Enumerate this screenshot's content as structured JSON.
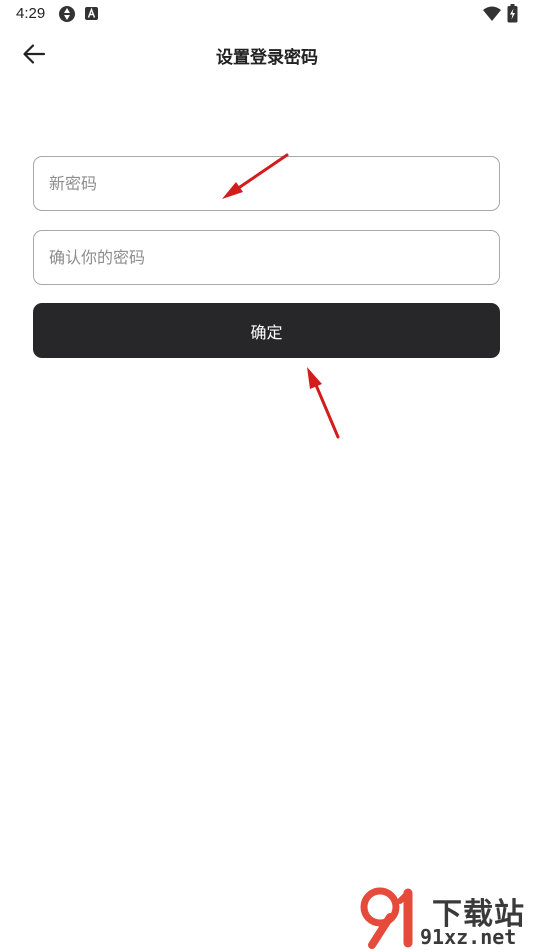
{
  "status_bar": {
    "time": "4:29",
    "icons": [
      "sync-icon",
      "a-badge-icon",
      "wifi-icon",
      "battery-charging-icon"
    ]
  },
  "header": {
    "back_icon": "arrow-left-icon",
    "title": "设置登录密码"
  },
  "form": {
    "new_password": {
      "placeholder": "新密码",
      "value": ""
    },
    "confirm_password": {
      "placeholder": "确认你的密码",
      "value": ""
    },
    "submit_label": "确定"
  },
  "annotations": {
    "arrow_color": "#d21d1d",
    "arrows": [
      "red-arrow-to-new-password",
      "red-arrow-to-confirm-button"
    ]
  },
  "watermark": {
    "text_cn": "下载站",
    "text_en": "91xz.net",
    "logo_color": "#e64a3b"
  },
  "colors": {
    "background": "#ffffff",
    "button": "#272729",
    "field_border": "#a8a8a8",
    "placeholder": "#8d8d8d"
  }
}
